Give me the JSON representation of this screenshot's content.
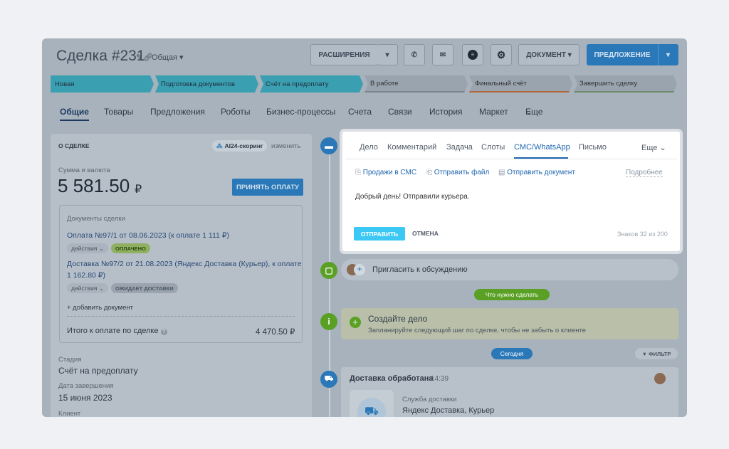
{
  "header": {
    "title": "Сделка #231",
    "edit_icon": "pencil-icon",
    "link_icon": "link-icon",
    "category": "Общая",
    "extensions_label": "РАСШИРЕНИЯ",
    "document_label": "ДОКУМЕНТ",
    "offer_label": "ПРЕДЛОЖЕНИЕ"
  },
  "stages": [
    {
      "label": "Новая"
    },
    {
      "label": "Подготовка документов"
    },
    {
      "label": "Счёт на предоплату"
    },
    {
      "label": "В работе"
    },
    {
      "label": "Финальный счёт"
    },
    {
      "label": "Завершить сделку"
    }
  ],
  "tabs": [
    "Общие",
    "Товары",
    "Предложения",
    "Роботы",
    "Бизнес-процессы",
    "Счета",
    "Связи",
    "История",
    "Маркет",
    "Еще"
  ],
  "deal": {
    "section_title": "О СДЕЛКЕ",
    "scoring": "AI24-скоринг",
    "change": "изменить",
    "sum_label": "Сумма и валюта",
    "sum_value": "5 581.50",
    "currency": "₽",
    "pay_button": "ПРИНЯТЬ ОПЛАТУ",
    "docs_title": "Документы сделки",
    "doc1_link": "Оплата №97/1 от 08.06.2023 (к оплате 1 111 ₽)",
    "doc1_actions": "действия",
    "doc1_status": "ОПЛАЧЕНО",
    "doc2_link_a": "Доставка №97/2 от 21.08.2023 (Яндекс Доставка (Курьер), к оплате",
    "doc2_link_b": "1 162.80 ₽)",
    "doc2_actions": "действия",
    "doc2_status": "ОЖИДАЕТ ДОСТАВКИ",
    "add_doc": "+ добавить документ",
    "total_label": "Итого к оплате по сделке",
    "total_value": "4 470.50 ₽",
    "stage_label": "Стадия",
    "stage_value": "Счёт на предоплату",
    "date_label": "Дата завершения",
    "date_value": "15 июня 2023",
    "client_label": "Клиент"
  },
  "composer": {
    "tabs": [
      "Дело",
      "Комментарий",
      "Задача",
      "Слоты",
      "СМС/WhatsApp",
      "Письмо",
      "Еще"
    ],
    "active_tab": "СМС/WhatsApp",
    "action1": "Продажи в СМС",
    "action2": "Отправить файл",
    "action3": "Отправить документ",
    "more": "Подробнее",
    "text": "Добрый день! Отправили курьера.",
    "send": "ОТПРАВИТЬ",
    "cancel": "ОТМЕНА",
    "counter": "Знаков 32 из 200"
  },
  "feed": {
    "invite": "Пригласить к обсуждению",
    "todo_badge": "Что нужно сделать",
    "create_title": "Создайте дело",
    "create_hint": "Запланируйте следующий шаг по сделке, чтобы не забыть о клиенте",
    "today": "Сегодня",
    "filter": "ФИЛЬТР",
    "delivery_title": "Доставка обработана",
    "delivery_time": "14:39",
    "service_label": "Служба доставки",
    "service_value": "Яндекс Доставка, Курьер"
  },
  "colors": {
    "accent": "#2067b0",
    "stage_done": "#3a9fb0",
    "green": "#5aa025"
  }
}
